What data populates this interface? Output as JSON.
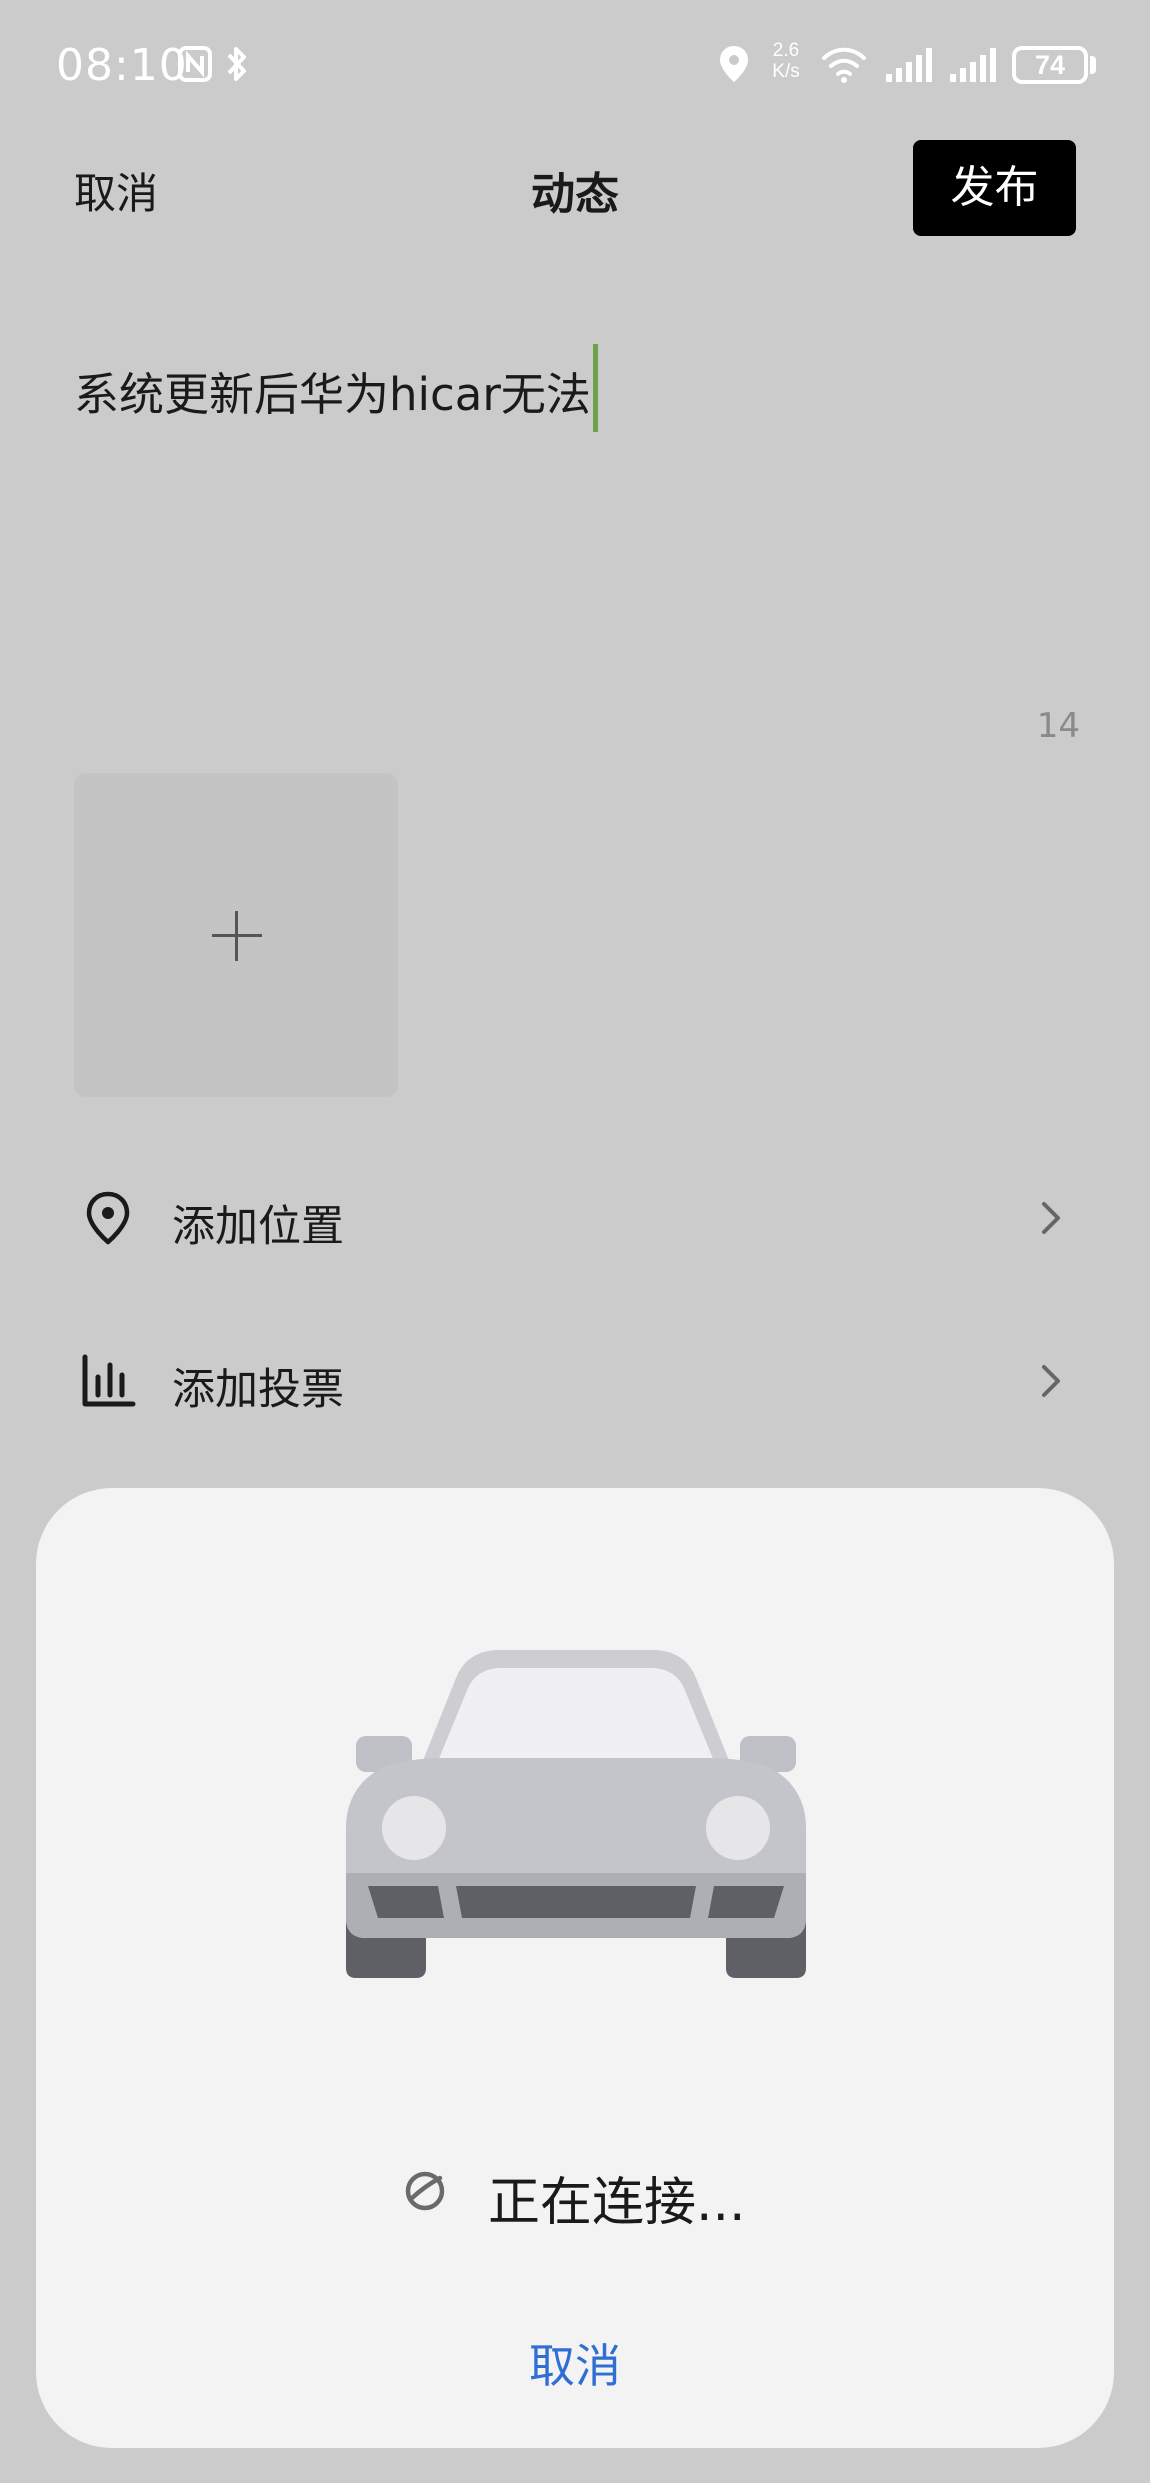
{
  "status_bar": {
    "time": "08:10",
    "net_speed_value": "2.6",
    "net_speed_unit": "K/s",
    "battery": "74",
    "icons": [
      "nfc-icon",
      "bluetooth-icon",
      "location-icon",
      "wifi-icon",
      "signal-icon",
      "signal-icon",
      "battery-icon"
    ]
  },
  "header": {
    "cancel_label": "取消",
    "title": "动态",
    "publish_label": "发布"
  },
  "editor": {
    "text": "系统更新后华为hicar无法",
    "char_count": "14"
  },
  "add_image": {
    "icon": "plus-icon"
  },
  "options": [
    {
      "label": "添加位置",
      "icon": "location-pin-icon"
    },
    {
      "label": "添加投票",
      "icon": "poll-icon"
    }
  ],
  "connect_sheet": {
    "illustration": "car-icon",
    "status": "正在连接...",
    "cancel_label": "取消"
  },
  "colors": {
    "background": "#cbcbcb",
    "publish_button": "#000000",
    "cursor": "#6fa04a",
    "sheet": "#f3f3f4",
    "link": "#2f6fd4"
  }
}
